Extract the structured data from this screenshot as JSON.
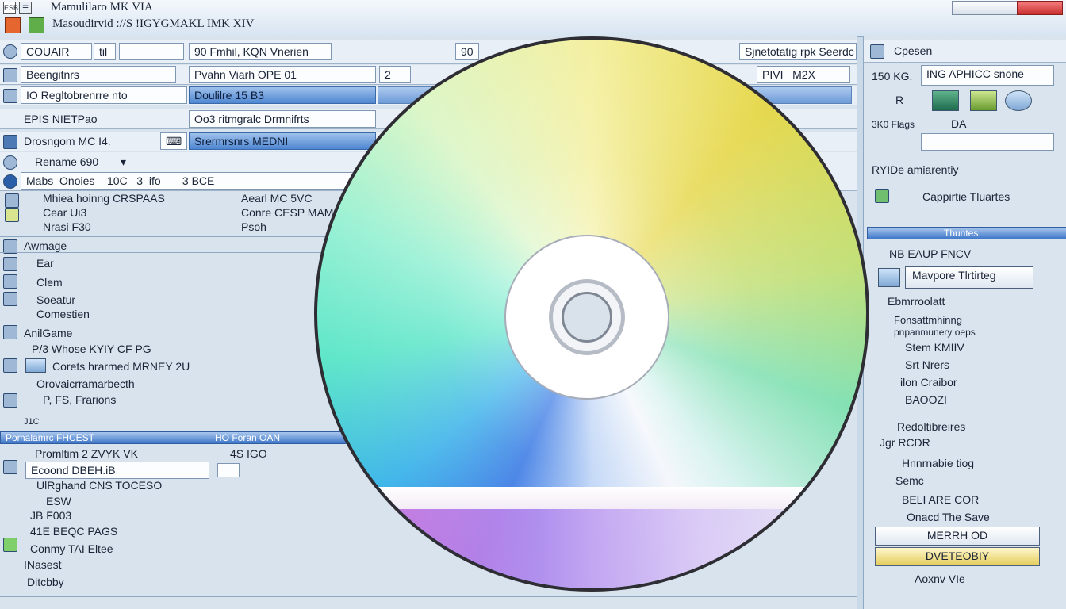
{
  "window": {
    "title1": "Mamulilaro MK VIA",
    "title2": "Masoudirvid ://S !IGYGMAKL IMK XIV",
    "icon_text": "ESB"
  },
  "toolbar": {
    "cell1": "COUAIR",
    "cell2": "til",
    "cell3": "90",
    "cell3_text": "Fmhil, KQN Vnerien",
    "cell4": "90",
    "cell5": "Sjnetotatig rpk Seerdc",
    "right_label": "Cpesen"
  },
  "main": {
    "rows": [
      {
        "label": "Beengitnrs",
        "mid": "Pvahn  Viarh",
        "mid2": "OPE",
        "mid3": "01",
        "num": "2",
        "right": "PIVI",
        "right2": "M2X"
      },
      {
        "label": "IO Regltobrenrre nto",
        "mid": "Doulilre",
        "mid2": "15",
        "mid3": "B3"
      },
      {
        "label": "EPIS NIETPao",
        "mid": "Oo3 ritmgralc Drmnifrts"
      },
      {
        "label": "Drosngom MC I4.",
        "mid": "Srermrsnrs",
        "mid2": "MEDNI"
      },
      {
        "label": "Rename 690"
      }
    ],
    "list_header": [
      "Mabs",
      "Onoies",
      "10C",
      "3",
      "ifo",
      "3",
      "BCE"
    ],
    "list_items": [
      {
        "a": "Mhiea hoinng  CRSPAAS",
        "b": "Aearl MC 5VC"
      },
      {
        "a": "Cear Ui3",
        "b": "Conre CESP MAM"
      },
      {
        "a": "Nrasi F30",
        "b": "Psoh"
      }
    ],
    "section_title": "Awmage",
    "section_items": [
      "Ear",
      "Clem",
      "Soeatur",
      "Comestien"
    ],
    "game_title": "AnilGame",
    "game_items": [
      "P/3 Whose KYIY CF PG",
      "Corets hrarmed MRNEY 2U",
      "Orovaicrramarbecth",
      "P, FS, Frarions"
    ],
    "footer_label": "J1C",
    "bar_left": "Pomalamrc FHCEST",
    "bar_right": "HO Foran OAN",
    "bottom_line": "Promltim 2 ZVYK VK",
    "bottom_num": "4S IGO",
    "bottom_field": "Ecoond DBEH.iB",
    "bottom_items": [
      "UlRghand CNS TOCESO",
      "ESW",
      "JB F003",
      "41E BEQC PAGS",
      "Conmy TAI Eltee",
      "INasest",
      "Ditcbby"
    ]
  },
  "right_panel": {
    "tab": "Cpesen",
    "rows": [
      "150 KG.",
      "R",
      "3K0 Flags"
    ],
    "cta": "ING APHICC snone",
    "badge": "DA",
    "status1": "RYIDe amiarentiy",
    "status2": "Cappirtie Tluartes",
    "bar": "Thuntes",
    "subheader": "NB EAUP FNCV",
    "button1": "Mavpore Tlrtirteg",
    "section": "Ebmrroolatt",
    "items": [
      "Fonsattmhinng",
      "pnpanmunery oeps",
      "Stem KMIIV",
      "Srt Nrers",
      "ilon Craibor",
      "BAOOZI"
    ],
    "section2": "Redoltibreires",
    "section2_b": "Jgr RCDR",
    "items2": [
      "Hnnrnabie tiog",
      "Semc",
      "BELI ARE COR",
      "Onacd The Save"
    ],
    "button2": "MERRH OD",
    "button3": "DVETEOBIY",
    "footer": "Aoxnv VIe"
  }
}
